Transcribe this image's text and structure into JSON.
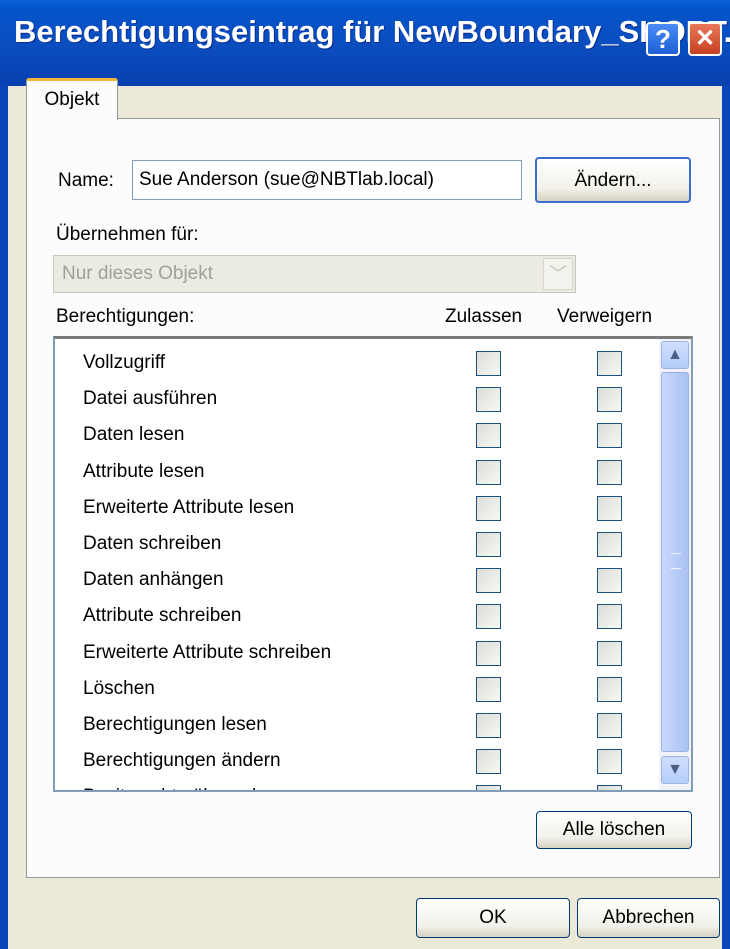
{
  "window": {
    "title": "Berechtigungseintrag für NewBoundary_SHORT...",
    "help_label": "?",
    "close_label": "✕"
  },
  "tabs": [
    {
      "label": "Objekt"
    }
  ],
  "name_label": "Name:",
  "name_value": "Sue Anderson (sue@NBTlab.local)",
  "change_button": "Ändern...",
  "apply_label": "Übernehmen für:",
  "apply_value": "Nur dieses Objekt",
  "permissions_header": "Berechtigungen:",
  "allow_header": "Zulassen",
  "deny_header": "Verweigern",
  "permissions": [
    {
      "label": "Vollzugriff"
    },
    {
      "label": "Datei ausführen"
    },
    {
      "label": "Daten lesen"
    },
    {
      "label": "Attribute lesen"
    },
    {
      "label": "Erweiterte Attribute lesen"
    },
    {
      "label": "Daten schreiben"
    },
    {
      "label": "Daten anhängen"
    },
    {
      "label": "Attribute schreiben"
    },
    {
      "label": "Erweiterte Attribute schreiben"
    },
    {
      "label": "Löschen"
    },
    {
      "label": "Berechtigungen lesen"
    },
    {
      "label": "Berechtigungen ändern"
    },
    {
      "label": "Besitzrechte übernehmen"
    }
  ],
  "clear_all_button": "Alle löschen",
  "ok_button": "OK",
  "cancel_button": "Abbrechen",
  "colors": {
    "title_bar": "#0a4ec0",
    "dialog_bg": "#ece9d8",
    "tab_accent": "#f5b53b"
  }
}
